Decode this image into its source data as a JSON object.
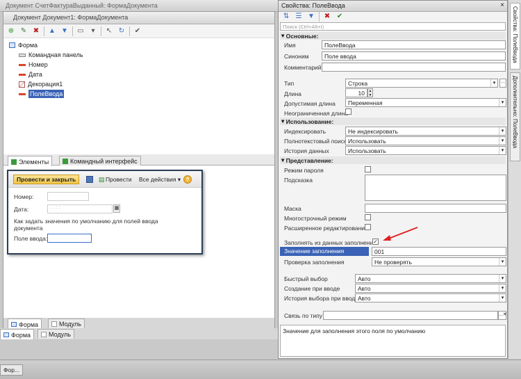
{
  "outer_window": {
    "title": "Документ СчетФактураВыданный: ФормаДокумента"
  },
  "editor": {
    "title": "Документ Документ1: ФормаДокумента",
    "tree": [
      {
        "label": "Форма",
        "icon": "form-icon"
      },
      {
        "label": "Командная панель",
        "icon": "command-panel-icon"
      },
      {
        "label": "Номер",
        "icon": "field-icon"
      },
      {
        "label": "Дата",
        "icon": "field-icon"
      },
      {
        "label": "Декорация1",
        "icon": "decoration-icon"
      },
      {
        "label": "ПолеВвода",
        "icon": "field-icon"
      }
    ],
    "tabs": {
      "elements": "Элементы",
      "command_interface": "Командный интерфейс"
    },
    "bottom_tabs": {
      "form": "Форма",
      "module": "Модуль"
    }
  },
  "preview": {
    "post_close": "Провести и закрыть",
    "post": "Провести",
    "all_actions": "Все действия",
    "number_label": "Номер:",
    "date_label": "Дата:",
    "date_value": ". .   : :",
    "decoration": "Как задать значения по умолчанию для полей ввода документа",
    "input_label": "Поле ввода:"
  },
  "outer_bottom_tabs": {
    "form": "Форма",
    "module": "Модуль"
  },
  "props": {
    "title": "Свойства: ПолеВвода",
    "search_placeholder": "Поиск (Ctrl+Alt+I)",
    "sections": {
      "main": "Основные:",
      "usage": "Использование:",
      "view": "Представление:"
    },
    "main": {
      "name_label": "Имя",
      "name_value": "ПолеВвода",
      "synonym_label": "Синоним",
      "synonym_value": "Поле ввода",
      "comment_label": "Комментарий"
    },
    "type": {
      "type_label": "Тип",
      "type_value": "Строка",
      "length_label": "Длина",
      "length_value": "10",
      "allowed_label": "Допустимая длина",
      "allowed_value": "Переменная",
      "unlimited_label": "Неограниченная длина"
    },
    "usage": {
      "index_label": "Индексировать",
      "index_value": "Не индексировать",
      "fulltext_label": "Полнотекстовый поиск",
      "fulltext_value": "Использовать",
      "history_label": "История данных",
      "history_value": "Использовать"
    },
    "view": {
      "password_label": "Режим пароля",
      "tooltip_label": "Подсказка",
      "mask_label": "Маска",
      "multiline_label": "Многострочный режим",
      "extended_label": "Расширенное редактирование",
      "fill_from_data_label": "Заполнять из данных заполнения",
      "fill_value_label": "Значение заполнения",
      "fill_value": "001",
      "fill_check_label": "Проверка заполнения",
      "fill_check_value": "Не проверять",
      "quick_choice_label": "Быстрый выбор",
      "quick_choice_value": "Авто",
      "create_on_input_label": "Создание при вводе",
      "create_on_input_value": "Авто",
      "choice_history_label": "История выбора при вводе",
      "choice_history_value": "Авто",
      "type_link_label": "Связь по типу"
    },
    "hint": "Значение для заполнения этого поля по умолчанию"
  },
  "side_tabs": {
    "properties": "Свойства: ПолеВвода",
    "additional": "Дополнительно: ПолеВвода"
  },
  "taskbar": {
    "item": "Фор..."
  },
  "colors": {
    "selection": "#3a62b6",
    "arrow": "#e02020",
    "preview_border": "#2c3e57"
  }
}
